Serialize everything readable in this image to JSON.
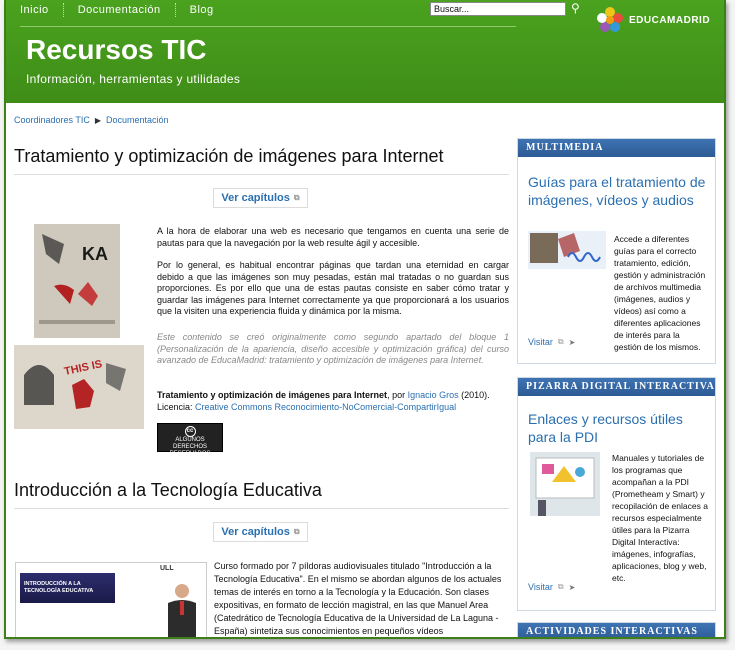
{
  "header": {
    "nav": [
      "Inicio",
      "Documentación",
      "Blog"
    ],
    "search_placeholder": "Buscar...",
    "logo_text": "EDUCAMADRID",
    "site_title": "Recursos TIC",
    "site_subtitle": "Información, herramientas y utilidades"
  },
  "breadcrumb": [
    "Coordinadores TIC",
    "Documentación"
  ],
  "sections": [
    {
      "title": "Tratamiento y optimización de imágenes para Internet",
      "chapters_label": "Ver capítulos",
      "paragraphs": [
        "A la hora de elaborar una web es necesario que tengamos en cuenta una serie de pautas para que la navegación por la web resulte ágil y accesible.",
        "Por lo general, es habitual encontrar páginas que tardan una eternidad en cargar debido a que las imágenes son muy pesadas, están mal tratadas o no guardan sus proporciones. Es por ello que una de estas pautas consiste en saber cómo tratar y guardar las imágenes para Internet correctamente ya que proporcionará a los usuarios que la visiten una experiencia fluida y dinámica por la misma."
      ],
      "note": "Este contenido se creó originalmente como segundo apartado del bloque 1 (Personalización de la apariencia, diseño accesible y optimización gráfica) del curso avanzado de EducaMadrid: tratamiento y optimización de imágenes para Internet.",
      "credit": {
        "work": "Tratamiento y optimización de imágenes para Internet",
        "by": ", por ",
        "author": "Ignacio Gros",
        "year": " (2010).",
        "license_label": "Licencia: ",
        "license": "Creative Commons Reconocimiento-NoComercial-CompartirIgual"
      },
      "cc_badge": {
        "symbol": "cc",
        "line1": "ALGUNOS DERECHOS",
        "line2": "RESERVADOS"
      }
    },
    {
      "title": "Introducción a la Tecnología Educativa",
      "chapters_label": "Ver capítulos",
      "paragraph": "Curso formado por 7 píldoras audiovisuales titulado \"Introducción a la Tecnología Educativa\". En el mismo se abordan algunos de los actuales temas de interés en torno a la Tecnología y la Educación. Son clases expositivas, en formato de lección magistral, en las que Manuel Area (Catedrático de Tecnología Educativa de la Universidad de La Laguna - España) sintetiza sus conocimientos en pequeños vídeos",
      "thumb_text": "INTRODUCCIÓN A LA TECNOLOGÍA EDUCATIVA",
      "thumb_brand": "ULL"
    }
  ],
  "sidebar": [
    {
      "header": "Multimedia",
      "title": "Guías para el tratamiento de imágenes, vídeos y audios",
      "text": "Accede a diferentes guías para el correcto tratamiento, edición, gestión y administración de archivos multimedia (imágenes, audios y vídeos) así como a diferentes aplicaciones de interés para la gestión de los mismos.",
      "link": "Visitar"
    },
    {
      "header": "Pizarra Digital Interactiva",
      "title": "Enlaces y recursos útiles para la PDI",
      "text": "Manuales y tutoriales de los programas que acompañan a la PDI (Prometheam y Smart) y recopilación de enlaces a recursos especialmente útiles para la Pizarra Digital Interactiva: imágenes, infografías, aplicaciones, blog y web, etc.",
      "link": "Visitar"
    },
    {
      "header": "Actividades Interactivas"
    }
  ],
  "colors": {
    "header_green": "#44991c",
    "link_blue": "#2a6fb0",
    "box_header": "#33649f"
  }
}
